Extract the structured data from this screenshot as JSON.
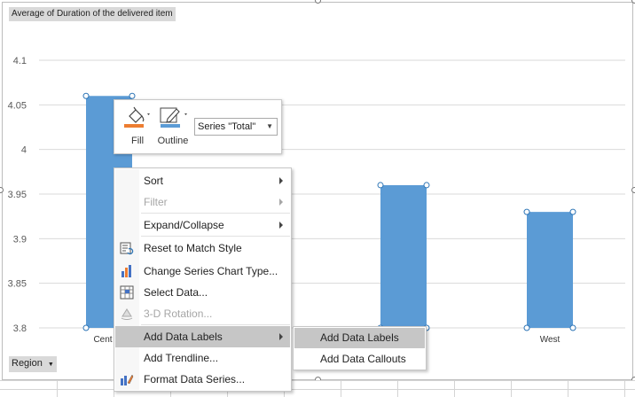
{
  "field_buttons": {
    "value_field": "Average of Duration of the delivered item",
    "axis_field": "Region"
  },
  "chart_data": {
    "type": "bar",
    "categories": [
      "Central",
      "",
      "",
      "West"
    ],
    "values": [
      4.06,
      null,
      3.96,
      3.93
    ],
    "yticks": [
      "3.8",
      "3.85",
      "3.9",
      "3.95",
      "4",
      "4.05",
      "4.1"
    ],
    "ylim": [
      3.8,
      4.1
    ],
    "grid": true,
    "bar_color": "#5b9bd5"
  },
  "category_labels": {
    "first": "Cent",
    "last": "West"
  },
  "mini_toolbar": {
    "fill_label": "Fill",
    "outline_label": "Outline",
    "series_select_value": "Series \"Total\"",
    "fill_icon": "paint-bucket-icon",
    "outline_icon": "pen-outline-icon",
    "fill_color": "#ed7d31",
    "outline_color": "#5b9bd5"
  },
  "context_menu": {
    "items": [
      {
        "label": "Sort",
        "disabled": false,
        "submenu": true,
        "icon": ""
      },
      {
        "label": "Filter",
        "disabled": true,
        "submenu": true,
        "icon": ""
      },
      {
        "label": "Expand/Collapse",
        "disabled": false,
        "submenu": true,
        "icon": ""
      },
      {
        "label": "Reset to Match Style",
        "disabled": false,
        "submenu": false,
        "icon": "reset-style-icon"
      },
      {
        "label": "Change Series Chart Type...",
        "disabled": false,
        "submenu": false,
        "icon": "chart-type-icon"
      },
      {
        "label": "Select Data...",
        "disabled": false,
        "submenu": false,
        "icon": "select-data-icon"
      },
      {
        "label": "3-D Rotation...",
        "disabled": true,
        "submenu": false,
        "icon": "rotation-icon"
      },
      {
        "label": "Add Data Labels",
        "disabled": false,
        "submenu": true,
        "icon": ""
      },
      {
        "label": "Add Trendline...",
        "disabled": false,
        "submenu": false,
        "icon": ""
      },
      {
        "label": "Format Data Series...",
        "disabled": false,
        "submenu": false,
        "icon": "format-series-icon"
      }
    ]
  },
  "sub_menu": {
    "items": [
      {
        "label": "Add Data Labels"
      },
      {
        "label": "Add Data Callouts"
      }
    ]
  }
}
